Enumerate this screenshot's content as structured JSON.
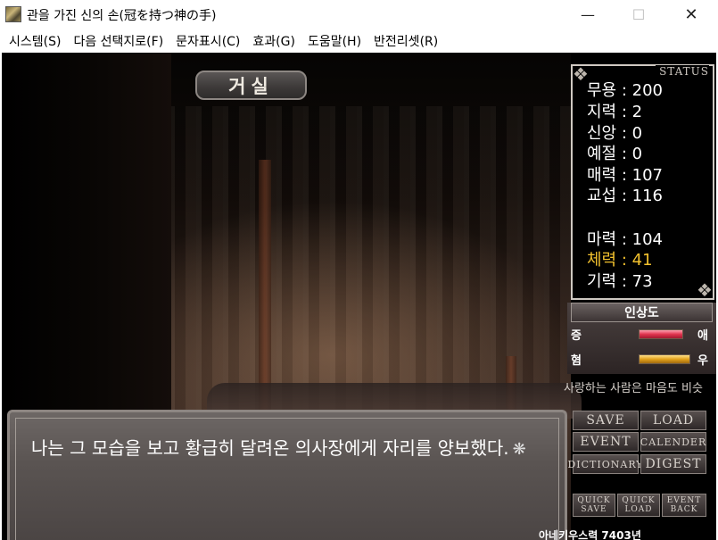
{
  "window": {
    "title": "관을 가진 신의 손(冠を持つ神の手)",
    "min_glyph": "—",
    "max_glyph": "☐",
    "close_glyph": "✕"
  },
  "menu": [
    "시스템(S)",
    "다음 선택지로(F)",
    "문자표시(C)",
    "효과(G)",
    "도움말(H)",
    "반전리셋(R)"
  ],
  "scene": {
    "location": "거실"
  },
  "status": {
    "title": "STATUS",
    "stats": [
      {
        "label": "무용",
        "value": "200"
      },
      {
        "label": "지력",
        "value": "2"
      },
      {
        "label": "신앙",
        "value": "0"
      },
      {
        "label": "예절",
        "value": "0"
      },
      {
        "label": "매력",
        "value": "107"
      },
      {
        "label": "교섭",
        "value": "116"
      },
      {
        "label": "마력",
        "value": "104"
      },
      {
        "label": "체력",
        "value": "41"
      },
      {
        "label": "기력",
        "value": "73"
      }
    ],
    "highlight_color": "#f2c12e"
  },
  "affinity": {
    "title": "인상도",
    "love_left": "증",
    "love_right": "애",
    "friend_left": "혐",
    "friend_right": "우",
    "quote": "사랑하는 사람은 마음도 비슷"
  },
  "dialogue": {
    "text": "나는 그 모습을 보고 황급히 달려온 의사장에게 자리를 양보했다.",
    "cursor": "❋"
  },
  "buttons": {
    "save": "SAVE",
    "load": "LOAD",
    "event": "EVENT",
    "calender": "CALENDER",
    "dictionary": "DICTIONARY",
    "digest": "DIGEST",
    "quick_save": [
      "QUICK",
      "SAVE"
    ],
    "quick_load": [
      "QUICK",
      "LOAD"
    ],
    "event_back": [
      "EVENT",
      "BACK"
    ]
  },
  "date": "아네키우스력 7403년"
}
